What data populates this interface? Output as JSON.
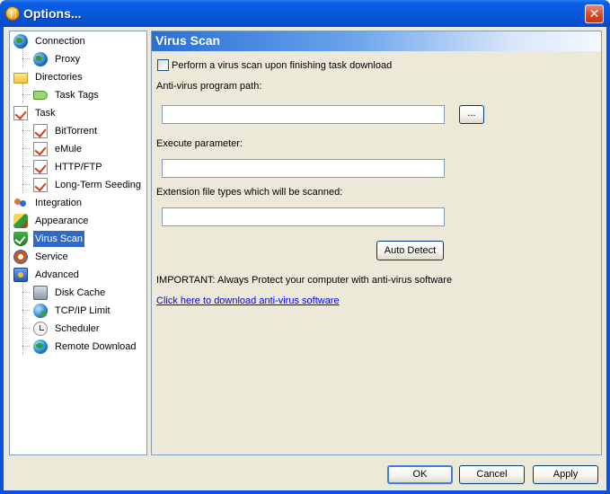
{
  "window": {
    "title": "Options..."
  },
  "tree": {
    "items": [
      {
        "label": "Connection",
        "icon": "connection-globe-icon"
      },
      {
        "label": "Proxy",
        "icon": "proxy-globe-icon"
      },
      {
        "label": "Directories",
        "icon": "folder-icon"
      },
      {
        "label": "Task Tags",
        "icon": "tag-icon"
      },
      {
        "label": "Task",
        "icon": "task-icon"
      },
      {
        "label": "BitTorrent",
        "icon": "task-icon"
      },
      {
        "label": "eMule",
        "icon": "task-icon"
      },
      {
        "label": "HTTP/FTP",
        "icon": "task-icon"
      },
      {
        "label": "Long-Term Seeding",
        "icon": "task-icon"
      },
      {
        "label": "Integration",
        "icon": "people-icon"
      },
      {
        "label": "Appearance",
        "icon": "paintbrush-icon"
      },
      {
        "label": "Virus Scan",
        "icon": "shield-icon"
      },
      {
        "label": "Service",
        "icon": "gear-icon"
      },
      {
        "label": "Advanced",
        "icon": "advanced-icon"
      },
      {
        "label": "Disk Cache",
        "icon": "disk-icon"
      },
      {
        "label": "TCP/IP Limit",
        "icon": "network-icon"
      },
      {
        "label": "Scheduler",
        "icon": "clock-icon"
      },
      {
        "label": "Remote Download",
        "icon": "remote-globe-icon"
      }
    ],
    "selected": "Virus Scan"
  },
  "panel": {
    "title": "Virus Scan",
    "scan_checkbox_label": "Perform a virus scan upon finishing task download",
    "scan_checkbox_checked": false,
    "av_path_label": "Anti-virus program path:",
    "av_path_value": "",
    "browse_label": "...",
    "exec_param_label": "Execute parameter:",
    "exec_param_value": "",
    "ext_types_label": "Extension file types which will be scanned:",
    "ext_types_value": "",
    "auto_detect_label": "Auto Detect",
    "important_text": "IMPORTANT: Always Protect your computer with anti-virus software",
    "download_link": "Click here to download anti-virus software"
  },
  "buttons": {
    "ok": "OK",
    "cancel": "Cancel",
    "apply": "Apply"
  },
  "colors": {
    "titlebar": "#0a5ce6",
    "selection": "#316ac5",
    "link": "#0000ff",
    "close": "#d4451c"
  }
}
